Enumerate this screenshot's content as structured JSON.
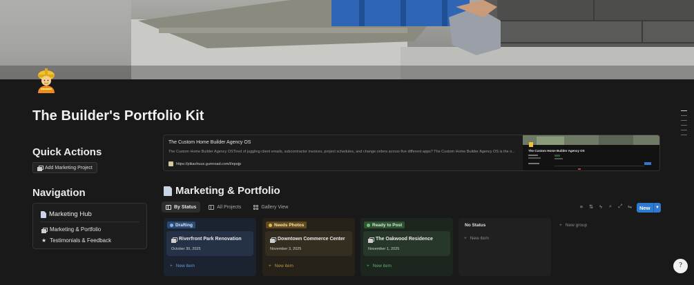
{
  "page": {
    "title": "The Builder's Portfolio Kit",
    "icon": "construction-worker-icon"
  },
  "quick_actions": {
    "heading": "Quick Actions",
    "add_button": "Add Marketing Project"
  },
  "navigation": {
    "heading": "Navigation",
    "hub": "Marketing Hub",
    "links": [
      "Marketing & Portfolio",
      "Testimonials & Feedback"
    ]
  },
  "bookmark": {
    "title": "The Custom Home Builder Agency OS",
    "description": "The Custom Home Builder Agency OSTired of juggling client emails, subcontractor invoices, project schedules, and change orders across five different apps? The Custom Home Builder Agency OS is the o...",
    "url": "https://pikachuux.gumroad.com/l/epojp",
    "thumb_title": "The Custom Home Builder Agency OS"
  },
  "database": {
    "title": "Marketing & Portfolio",
    "tabs": [
      "By Status",
      "All Projects",
      "Gallery View"
    ],
    "new_button": "New",
    "columns": [
      {
        "label": "Drafting",
        "card_title": "Riverfront Park Renovation",
        "card_date": "October 30, 2025",
        "new_item": "New item",
        "color": "#2b4a72"
      },
      {
        "label": "Needs Photos",
        "card_title": "Downtown Commerce Center",
        "card_date": "November 3, 2025",
        "new_item": "New item",
        "color": "#5e4a1e"
      },
      {
        "label": "Ready to Post",
        "card_title": "The Oakwood Residence",
        "card_date": "November 1, 2025",
        "new_item": "New item",
        "color": "#2f5232"
      },
      {
        "label": "No Status",
        "new_item": "New item"
      }
    ],
    "new_group": "New group"
  },
  "help": {
    "label": "?"
  }
}
